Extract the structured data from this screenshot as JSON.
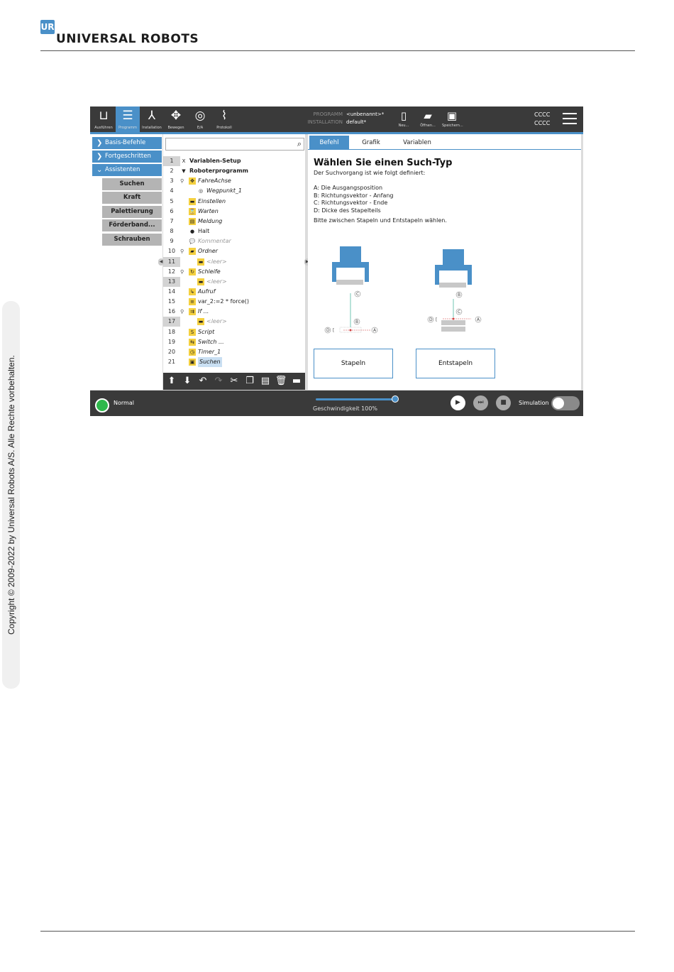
{
  "page": {
    "brand_mark": "UR",
    "brand": "UNIVERSAL ROBOTS",
    "copyright": "Copyright © 2009-2022 by Universal Robots A/S. Alle Rechte vorbehalten."
  },
  "topbar": {
    "nav": [
      {
        "label": "Ausführen",
        "icon": "ur-logo-icon"
      },
      {
        "label": "Programm",
        "icon": "program-icon",
        "active": true
      },
      {
        "label": "Installation",
        "icon": "installation-icon"
      },
      {
        "label": "Bewegen",
        "icon": "move-icon"
      },
      {
        "label": "E/A",
        "icon": "io-icon"
      },
      {
        "label": "Protokoll",
        "icon": "log-icon"
      }
    ],
    "program_label": "PROGRAMM",
    "installation_label": "INSTALLATION",
    "program_value": "<unbenannt>*",
    "installation_value": "default*",
    "file_buttons": [
      {
        "label": "Neu...",
        "icon": "new-file-icon"
      },
      {
        "label": "Öffnen...",
        "icon": "open-folder-icon"
      },
      {
        "label": "Speichern...",
        "icon": "save-icon"
      }
    ],
    "cccc_1": "CCCC",
    "cccc_2": "CCCC"
  },
  "sidebar": {
    "categories": [
      "Basis-Befehle",
      "Fortgeschritten",
      "Assistenten"
    ],
    "assistants": [
      "Suchen",
      "Kraft",
      "Palettierung",
      "Förderband...",
      "Schrauben"
    ]
  },
  "tree": {
    "rows": [
      {
        "n": "1",
        "label": "Variablen-Setup",
        "icon": "X"
      },
      {
        "n": "2",
        "label": "Roboterprogramm",
        "icon": "▼"
      },
      {
        "n": "3",
        "label": "FahreAchse",
        "icon": "✥"
      },
      {
        "n": "4",
        "label": "Wegpunkt_1",
        "icon": "◎"
      },
      {
        "n": "5",
        "label": "Einstellen",
        "icon": "▬"
      },
      {
        "n": "6",
        "label": "Warten",
        "icon": "⌛"
      },
      {
        "n": "7",
        "label": "Meldung",
        "icon": "▤"
      },
      {
        "n": "8",
        "label": "Halt",
        "icon": "●"
      },
      {
        "n": "9",
        "label": "Kommentar",
        "icon": "💬"
      },
      {
        "n": "10",
        "label": "Ordner",
        "icon": "▰"
      },
      {
        "n": "11",
        "label": "<leer>",
        "icon": "▬"
      },
      {
        "n": "12",
        "label": "Schleife",
        "icon": "↻"
      },
      {
        "n": "13",
        "label": "<leer>",
        "icon": "▬"
      },
      {
        "n": "14",
        "label": "Aufruf",
        "icon": "↳"
      },
      {
        "n": "15",
        "label": "var_2:=2 * force()",
        "icon": "≡"
      },
      {
        "n": "16",
        "label": "If ...",
        "icon": "⇉"
      },
      {
        "n": "17",
        "label": "<leer>",
        "icon": "▬"
      },
      {
        "n": "18",
        "label": "Script",
        "icon": "S"
      },
      {
        "n": "19",
        "label": "Switch ...",
        "icon": "⇆"
      },
      {
        "n": "20",
        "label": "Timer_1",
        "icon": "◷"
      },
      {
        "n": "21",
        "label": "Suchen",
        "icon": "▣"
      }
    ]
  },
  "content": {
    "tabs": [
      "Befehl",
      "Grafik",
      "Variablen"
    ],
    "title": "Wählen Sie einen Such-Typ",
    "intro": "Der Suchvorgang ist wie folgt definiert:",
    "defs": [
      "A: Die Ausgangsposition",
      "B: Richtungsvektor - Anfang",
      "C: Richtungsvektor - Ende",
      "D: Dicke des Stapelteils"
    ],
    "instruction": "Bitte zwischen Stapeln und Entstapeln wählen.",
    "diagram_labels": [
      "A",
      "B",
      "C",
      "D"
    ],
    "buttons": [
      "Stapeln",
      "Entstapeln"
    ]
  },
  "footer": {
    "status": "Normal",
    "speed_label": "Geschwindigkeit 100%",
    "speed_percent": 100,
    "simulation_label": "Simulation",
    "simulation_on": false
  },
  "colors": {
    "accent": "#4a90c8",
    "bar": "#3a3a3a",
    "status_green": "#2fb84c",
    "tree_icon": "#f4d03f"
  }
}
